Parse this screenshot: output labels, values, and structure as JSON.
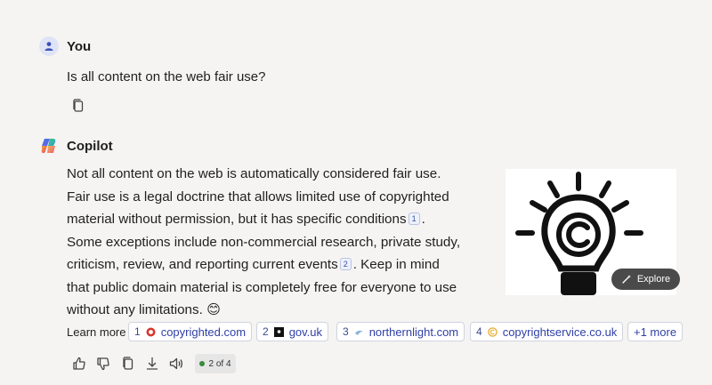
{
  "user": {
    "name": "You",
    "message": "Is all content on the web fair use?"
  },
  "copilot": {
    "name": "Copilot",
    "answer_parts": {
      "p1": "Not all content on the web is automatically considered fair use. Fair use is a legal doctrine that allows limited use of copyrighted material without permission, but it has specific conditions",
      "cite1": "1",
      "p2": ". Some exceptions include non-commercial research, private study, criticism, review, and reporting current events",
      "cite2": "2",
      "p3": ". Keep in mind that public domain material is completely free for everyone to use without any limitations.",
      "emoji": "😊"
    },
    "image": {
      "icon": "copyright-lightbulb-icon",
      "explore_label": "Explore"
    }
  },
  "learn_more": {
    "label": "Learn more",
    "sources": [
      {
        "num": "1",
        "site": "copyrighted.com",
        "favicon_color": "#d9342b"
      },
      {
        "num": "2",
        "site": "gov.uk",
        "favicon_color": "#111111"
      },
      {
        "num": "3",
        "site": "northernlight.com",
        "favicon_color": "#8ab4d8"
      },
      {
        "num": "4",
        "site": "copyrightservice.co.uk",
        "favicon_color": "#e6b23a"
      }
    ],
    "more_label": "+1 more"
  },
  "actions": {
    "icons": [
      "thumbs-up-icon",
      "thumbs-down-icon",
      "copy-icon",
      "download-icon",
      "read-aloud-icon"
    ],
    "pager": "2 of 4",
    "pager_dot_color": "#3a8a3a"
  }
}
